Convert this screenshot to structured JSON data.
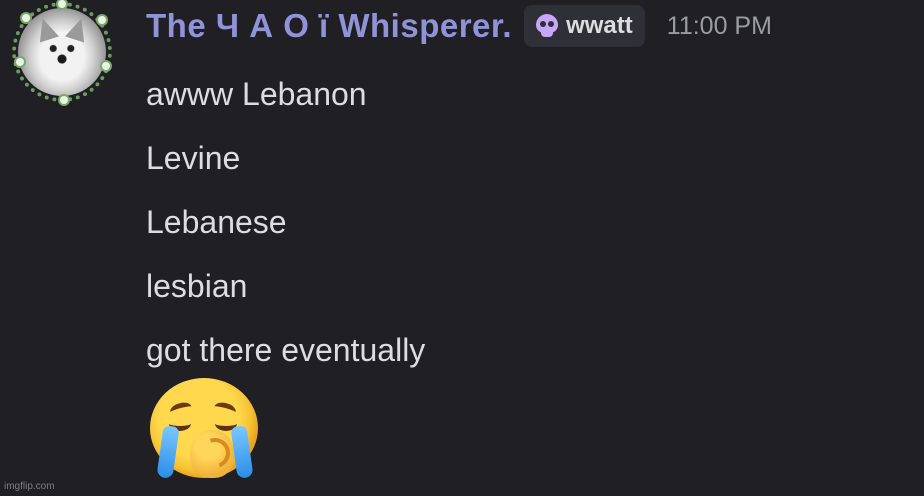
{
  "message": {
    "author": "The Ч А О ï  Whisperer.",
    "tag_icon": "skull-icon",
    "tag": "wwatt",
    "timestamp": "11:00 PM",
    "lines": [
      "awww Lebanon",
      "Levine",
      "Lebanese",
      "lesbian",
      "got there eventually"
    ],
    "emoji": "loudly-crying-face"
  },
  "colors": {
    "username": "#9093d8",
    "text": "#dcdde1",
    "timestamp": "#9a9ca3",
    "tag_bg": "#2f3037",
    "tag_icon": "#c7a7f7",
    "background": "#1f1f24"
  },
  "watermark": "imgflip.com"
}
